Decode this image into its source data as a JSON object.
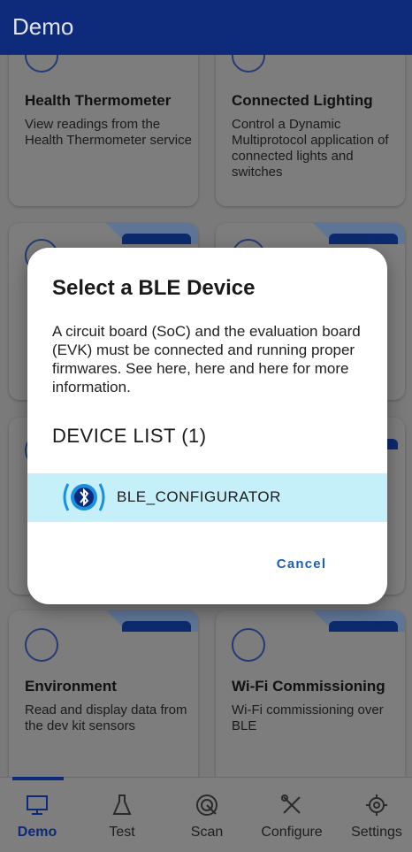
{
  "app": {
    "title": "Demo"
  },
  "cards": [
    {
      "title": "Health Thermometer",
      "description": "View readings from the Health Thermometer service",
      "icon": "thermometer-icon"
    },
    {
      "title": "Connected Lighting",
      "description": "Control a Dynamic Multiprotocol application of connected lights and switches",
      "icon": "light-bulb-icon"
    },
    {
      "title": "Environment",
      "description": "Read and display data from the dev kit sensors",
      "icon": "water-drop-icon"
    },
    {
      "title": "Wi-Fi Commissioning",
      "description": "Wi-Fi commissioning over BLE",
      "icon": "wifi-router-icon"
    }
  ],
  "dialog": {
    "title": "Select a BLE Device",
    "message": "A circuit board (SoC) and the evaluation board (EVK) must be connected and running proper firmwares. See here, here and here for more information.",
    "list_header": "DEVICE LIST (1)",
    "devices": [
      {
        "name": "BLE_CONFIGURATOR",
        "icon": "bluetooth-signal-icon"
      }
    ],
    "cancel_label": "Cancel"
  },
  "bottom_nav": {
    "items": [
      {
        "label": "Demo",
        "icon": "monitor-icon",
        "active": true
      },
      {
        "label": "Test",
        "icon": "flask-icon"
      },
      {
        "label": "Scan",
        "icon": "scan-icon"
      },
      {
        "label": "Configure",
        "icon": "tools-icon"
      },
      {
        "label": "Settings",
        "icon": "gear-icon"
      }
    ]
  },
  "colors": {
    "appbar": "#0e2a7a",
    "accent": "#0b2a7a",
    "selected_row": "#c6f0f9",
    "cancel_text": "#1b5fb5"
  }
}
